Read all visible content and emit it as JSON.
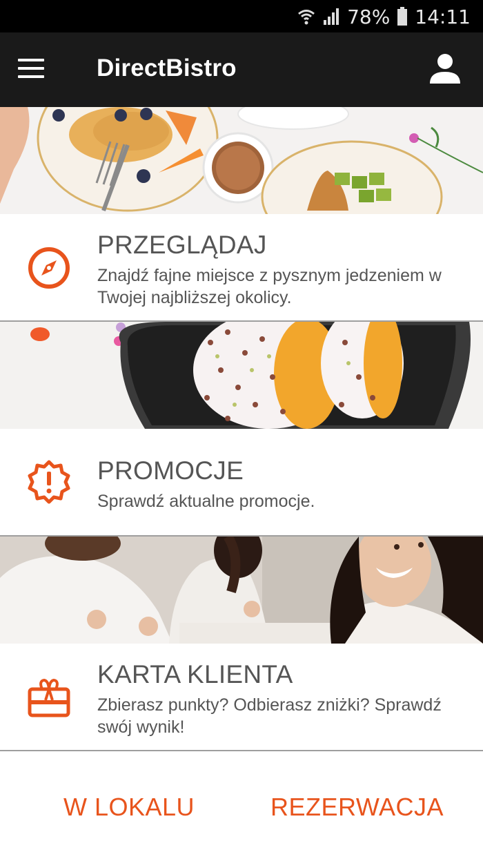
{
  "status_bar": {
    "battery": "78%",
    "time": "14:11"
  },
  "app_bar": {
    "title": "DirectBistro",
    "menu_icon": "hamburger-menu-icon",
    "profile_icon": "user-profile-icon"
  },
  "colors": {
    "accent": "#E8541C",
    "app_bar_bg": "#1A1A1A",
    "text": "#555555"
  },
  "sections": [
    {
      "icon": "compass-icon",
      "title": "PRZEGLĄDAJ",
      "description": "Znajdź fajne miejsce z pysznym jedzeniem w Twojej najbliższej okolicy."
    },
    {
      "icon": "promotion-badge-icon",
      "title": "PROMOCJE",
      "description": "Sprawdź aktualne promocje."
    },
    {
      "icon": "gift-card-icon",
      "title": "KARTA KLIENTA",
      "description": "Zbierasz punkty? Odbierasz zniżki? Sprawdź swój wynik!"
    }
  ],
  "bottom_actions": {
    "left": "W LOKALU",
    "right": "REZERWACJA"
  }
}
